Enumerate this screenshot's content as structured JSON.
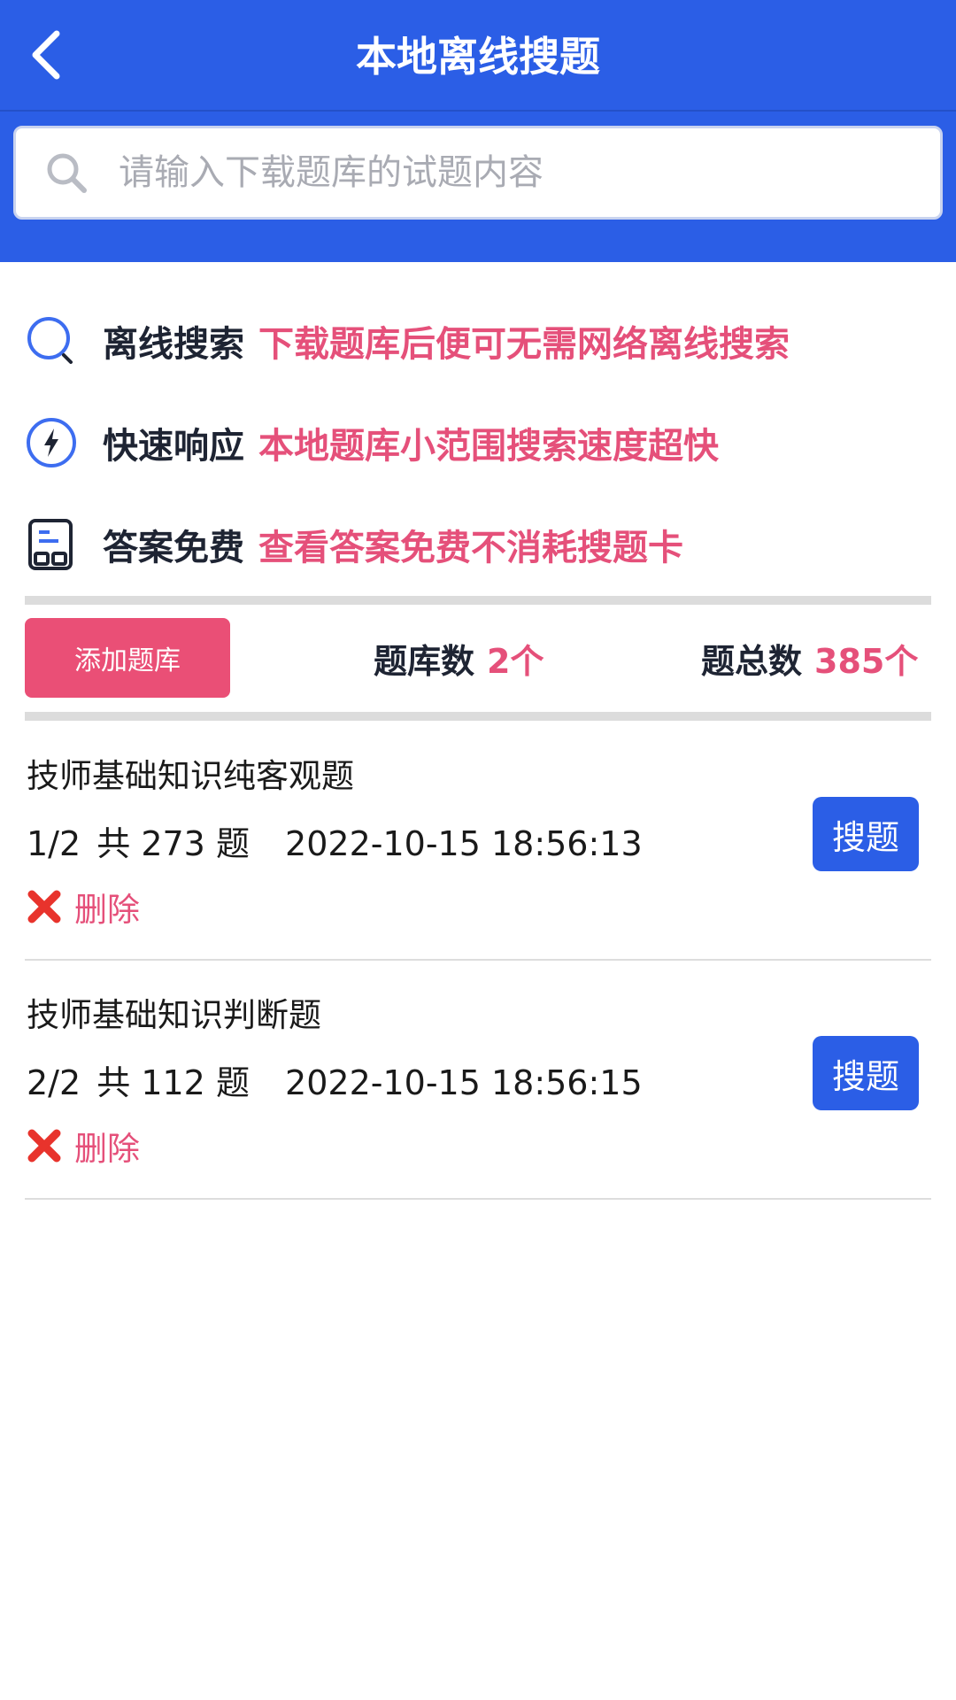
{
  "header": {
    "title": "本地离线搜题"
  },
  "search": {
    "placeholder": "请输入下载题库的试题内容"
  },
  "features": [
    {
      "title": "离线搜索",
      "desc": "下载题库后便可无需网络离线搜索",
      "icon": "search-circle-icon"
    },
    {
      "title": "快速响应",
      "desc": "本地题库小范围搜索速度超快",
      "icon": "lightning-icon"
    },
    {
      "title": "答案免费",
      "desc": "查看答案免费不消耗搜题卡",
      "icon": "document-icon"
    }
  ],
  "toolbar": {
    "add_label": "添加题库",
    "bank_count_label": "题库数",
    "bank_count_value": "2个",
    "total_label": "题总数",
    "total_value": "385个"
  },
  "banks": [
    {
      "name": "技师基础知识纯客观题",
      "index": "1/2",
      "count_text": "共 273 题",
      "date": "2022-10-15 18:56:13",
      "search_label": "搜题",
      "delete_label": "删除"
    },
    {
      "name": "技师基础知识判断题",
      "index": "2/2",
      "count_text": "共 112 题",
      "date": "2022-10-15 18:56:15",
      "search_label": "搜题",
      "delete_label": "删除"
    }
  ],
  "colors": {
    "primary": "#2b5ee6",
    "accent": "#e5507a",
    "add_button": "#ea4f76",
    "delete_icon": "#e8332c"
  }
}
